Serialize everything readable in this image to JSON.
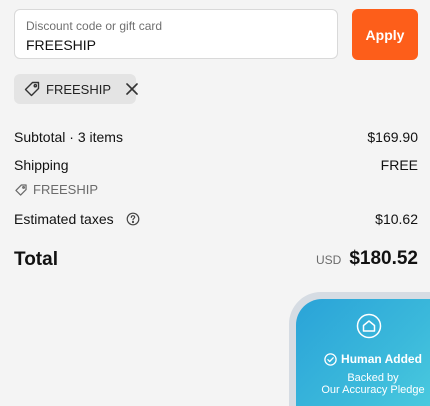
{
  "discount": {
    "label": "Discount code or gift card",
    "value": "FREESHIP",
    "apply_label": "Apply",
    "applied_code": "FREESHIP"
  },
  "summary": {
    "subtotal_label": "Subtotal · 3 items",
    "subtotal_value": "$169.90",
    "shipping_label": "Shipping",
    "shipping_value": "FREE",
    "shipping_discount_code": "FREESHIP",
    "taxes_label": "Estimated taxes",
    "taxes_value": "$10.62",
    "total_label": "Total",
    "total_currency": "USD",
    "total_value": "$180.52"
  },
  "badge": {
    "title": "Human Added",
    "subtitle_line1": "Backed by",
    "subtitle_line2": "Our Accuracy Pledge"
  },
  "colors": {
    "accent": "#fd5e1a",
    "badge_gradient_start": "#2aa3d8",
    "badge_gradient_end": "#4fd0e0"
  },
  "icons": [
    "tag-icon",
    "close-icon",
    "info-icon",
    "home-icon",
    "check-circle-icon"
  ]
}
